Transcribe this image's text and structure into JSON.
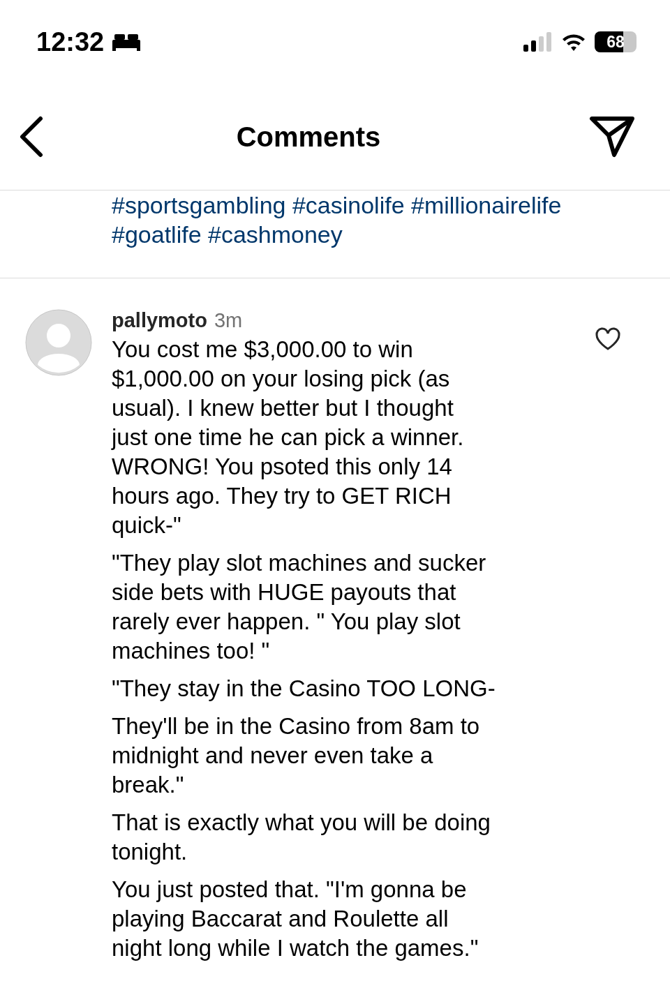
{
  "status_bar": {
    "time": "12:32",
    "battery": {
      "reading": "68",
      "level": 0.68
    }
  },
  "header": {
    "title": "Comments"
  },
  "caption": {
    "hashtags": "#sportsgambling #casinolife #millionairelife\n#goatlife #cashmoney"
  },
  "comments": [
    {
      "username": "pallymoto",
      "age": "3m",
      "liked": false,
      "paragraphs": [
        "You cost me $3,000.00 to win\n$1,000.00 on your losing pick (as\nusual). I knew better but I thought\njust one time he can pick a winner.\nWRONG!  You psoted this only 14\nhours ago. They try to GET RICH\nquick-\"",
        "\"They play slot machines and sucker\nside bets with HUGE payouts that\nrarely ever happen. \"  You play slot\nmachines too! \"",
        "\"They stay in the Casino TOO LONG-",
        "They'll be in the Casino from 8am to\nmidnight and never even take a\nbreak.\"",
        "That is exactly what you will be doing\ntonight.",
        "You just posted that. \"I'm gonna be\nplaying Baccarat and Roulette all\nnight long while I watch the games.\""
      ]
    }
  ]
}
